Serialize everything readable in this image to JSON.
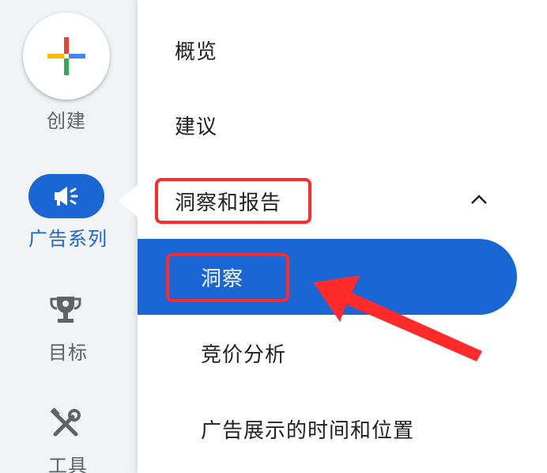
{
  "rail": {
    "create_label": "创建",
    "campaigns_label": "广告系列",
    "goals_label": "目标",
    "tools_label": "工具"
  },
  "menu": {
    "overview": "概览",
    "recommendations": "建议",
    "insights_and_reports": "洞察和报告",
    "insights": "洞察",
    "auction_insights": "竞价分析",
    "when_and_where_ads_showed": "广告展示的时间和位置"
  },
  "colors": {
    "accent": "#1a66d4",
    "annotation": "#ff2b2b",
    "rail_bg": "#f1f3f4"
  },
  "icons": [
    "plus-icon",
    "megaphone-icon",
    "trophy-icon",
    "tools-icon",
    "chevron-up-icon",
    "annotation-arrow"
  ]
}
